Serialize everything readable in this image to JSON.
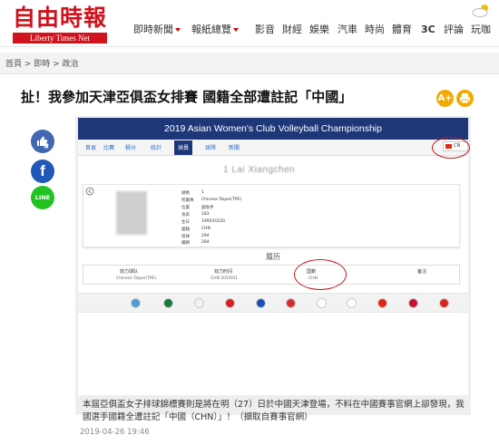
{
  "header": {
    "logo_zh": "自由時報",
    "logo_en": "Liberty Times Net",
    "nav": [
      {
        "label": "即時新聞",
        "dropdown": true
      },
      {
        "label": "報紙總覽",
        "dropdown": true
      },
      {
        "label": "影音"
      },
      {
        "label": "財經"
      },
      {
        "label": "娛樂"
      },
      {
        "label": "汽車"
      },
      {
        "label": "時尚"
      },
      {
        "label": "體育"
      },
      {
        "label": "3C"
      },
      {
        "label": "評論"
      },
      {
        "label": "玩咖"
      }
    ],
    "weather_icon": "partly-cloudy-icon"
  },
  "breadcrumb": "首頁 > 即時 > 政治",
  "article": {
    "title": "扯！我參加天津亞俱盃女排賽 國籍全部遭註記「中國」",
    "font_button": "A+",
    "caption": "本屆亞俱盃女子排球錦標賽則是將在明（27）日於中國天津登場，不料在中國賽事官網上卻發現，我國選手國籍全遭註記「中國（CHN）」！（擷取自賽事官網）",
    "date": "2019-04-26 19:46"
  },
  "share": {
    "like": "讚",
    "facebook": "f",
    "line": "LINE"
  },
  "screenshot": {
    "banner": "2019 Asian Women's Club Volleyball Championship",
    "tabs": [
      "首頁",
      "比賽",
      "積分",
      "統計",
      "球員",
      "球隊",
      "新聞"
    ],
    "active_tab": "球員",
    "country_code": "CN",
    "player_name": "1 Lai Xiangchen",
    "info_keys": [
      "號碼",
      "所屬隊",
      "位置",
      "身高",
      "生日",
      "國籍",
      "扣球",
      "攔網"
    ],
    "info_values": [
      "1",
      "Chinese Taipei(TPE)",
      "副攻手",
      "183",
      "1995/03/20",
      "CHN",
      "294",
      "284"
    ],
    "history_label": "履历",
    "history_headers": [
      "效力球队",
      "效力时间",
      "国籍",
      "备注"
    ],
    "history_values": [
      "Chinese Taipei(TPE)",
      "CHN 2019/01",
      "CHN",
      ""
    ],
    "flag_colors": [
      "#4a9bd6",
      "#1b7a3a",
      "#f2f2f2",
      "#d82020",
      "#1d4fb0",
      "#d32f2f",
      "#ffffff",
      "#ffffff",
      "#de2910",
      "#c8102e",
      "#da251d",
      "#f2a900"
    ]
  }
}
